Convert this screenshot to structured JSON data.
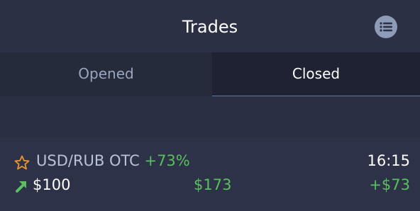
{
  "header": {
    "title": "Trades",
    "menu_icon": "list-icon"
  },
  "tabs": [
    {
      "label": "Opened",
      "active": false
    },
    {
      "label": "Closed",
      "active": true
    }
  ],
  "trade": {
    "favorite_icon": "star-outline-icon",
    "pair": "USD/RUB OTC",
    "percent": "+73%",
    "time": "16:15",
    "direction_icon": "arrow-up-right-icon",
    "amount": "$100",
    "payout": "$173",
    "profit": "+$73"
  },
  "colors": {
    "profit_green": "#5bbf5f",
    "star_orange": "#f0952d",
    "accent_blue": "#3f7fd6"
  }
}
